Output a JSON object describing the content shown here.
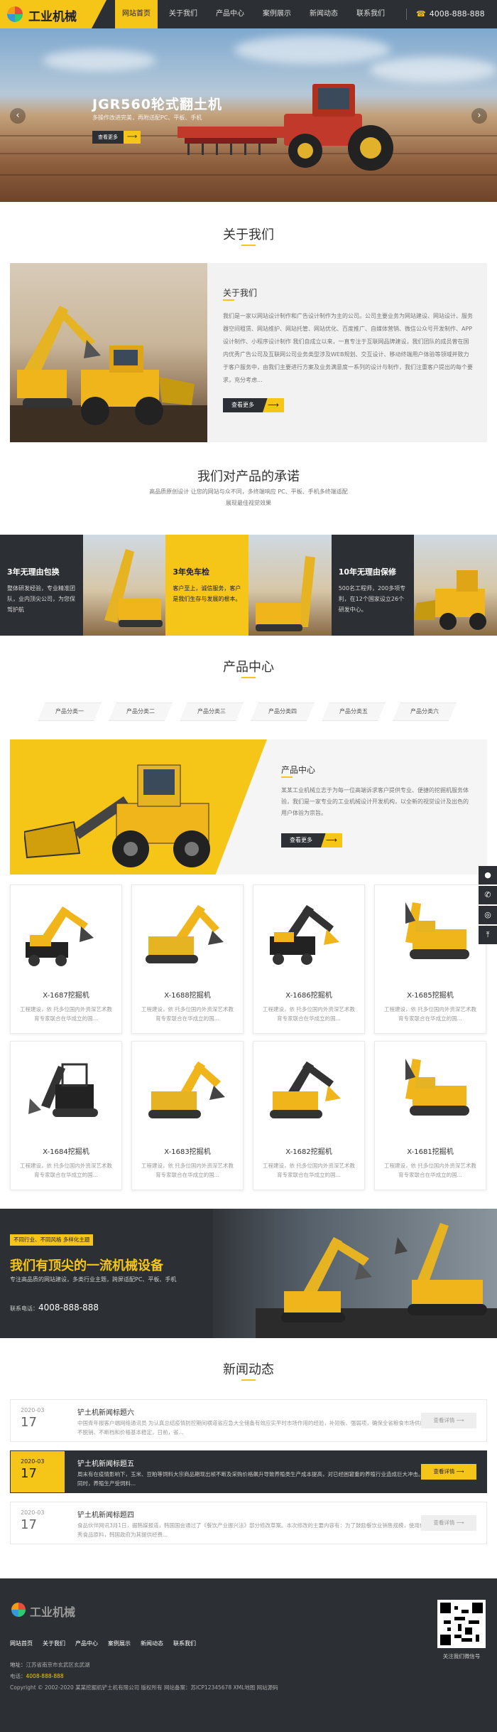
{
  "header": {
    "logo_text": "工业机械",
    "nav": [
      "网站首页",
      "关于我们",
      "产品中心",
      "案例展示",
      "新闻动态",
      "联系我们"
    ],
    "active_nav": 0,
    "phone_icon": "phone-icon",
    "phone": "4008-888-888"
  },
  "banner": {
    "title": "JGR560轮式翻土机",
    "subtitle": "多操作改进完美，再附送配PC、平板、手机",
    "button_label": "查看更多"
  },
  "about": {
    "section_title": "关于我们",
    "heading": "关于我们",
    "body": "我们是一家以网站设计制作和广告设计制作为主的公司。公司主要业务为网站建设、网站设计、服务器空间租赁、网站维护、网站托管、网站优化、百度推广、自媒体营销、微信公众号开发制作、APP设计制作、小程序设计制作 我们自成立以来，一直专注于互联网品牌建设，我们团队的成员曾在国内优秀广告公司及互联网公司业务类型涉及WEB规划、交互设计、移动终端用户体验等领域并致力于客户服务中，由我们主要进行方案及业务满意度一系列的设计与制作，我们注重客户提出的每个要求，充分考虑...",
    "button_label": "查看更多"
  },
  "promise": {
    "title": "我们对产品的承诺",
    "line1": "高品质原创设计 让您的网站与众不同，多终端响应 PC、平板、手机多终端适配",
    "line2": "展现最佳视觉效果",
    "items": [
      {
        "title": "3年无理由包换",
        "desc": "整体研发经验，专业精准团队，业内顶尖公司，为您保驾护航"
      },
      {
        "title": "3年免车检",
        "desc": "客户至上，诚信服务，客户是我们生存与发展的根本。"
      },
      {
        "title": "10年无理由保修",
        "desc": "500名工程师，200多项专利，在12个国家设立26个研发中心。"
      }
    ]
  },
  "products": {
    "section_title": "产品中心",
    "categories": [
      "产品分类一",
      "产品分类二",
      "产品分类三",
      "产品分类四",
      "产品分类五",
      "产品分类六"
    ],
    "heading": "产品中心",
    "body": "某某工业机械立志于为每一位高端诉求客户提供专业、便捷的挖掘机服务体验，我们是一家专业的工业机械设计开发机构，以全新的视觉设计及出色的用户体验为宗旨。",
    "button_label": "查看更多",
    "items": [
      {
        "name": "X-1687挖掘机",
        "desc": "工程建设，依 托多位国内外资深艺术教育专家联合在华成立的国..."
      },
      {
        "name": "X-1688挖掘机",
        "desc": "工程建设，依 托多位国内外资深艺术教育专家联合在华成立的国..."
      },
      {
        "name": "X-1686挖掘机",
        "desc": "工程建设，依 托多位国内外资深艺术教育专家联合在华成立的国..."
      },
      {
        "name": "X-1685挖掘机",
        "desc": "工程建设，依 托多位国内外资深艺术教育专家联合在华成立的国..."
      },
      {
        "name": "X-1684挖掘机",
        "desc": "工程建设，依 托多位国内外资深艺术教育专家联合在华成立的国..."
      },
      {
        "name": "X-1683挖掘机",
        "desc": "工程建设，依 托多位国内外资深艺术教育专家联合在华成立的国..."
      },
      {
        "name": "X-1682挖掘机",
        "desc": "工程建设，依 托多位国内外资深艺术教育专家联合在华成立的国..."
      },
      {
        "name": "X-1681挖掘机",
        "desc": "工程建设，依 托多位国内外资深艺术教育专家联合在华成立的国..."
      }
    ]
  },
  "side_tools": [
    "qq-icon",
    "phone-icon",
    "wechat-icon",
    "back-to-top-icon"
  ],
  "machinery": {
    "badge": "不同行业、不同风格 多样化主题",
    "title": "我们有顶尖的一流机械设备",
    "subtitle": "专注高品质的网站建设，多类行业主题，跨屏适配PC、平板、手机",
    "phone_label": "联系电话：",
    "phone": "4008-888-888"
  },
  "news": {
    "section_title": "新闻动态",
    "button_label": "查看详情 ⟶",
    "items": [
      {
        "ym": "2020-03",
        "day": "17",
        "title": "铲土机新闻标题六",
        "summary": "中国青年报客户端网络通讯员 为认真总结疫情防控期间横道省应急大全储备有效应实平时市场作用的经验，补短板、强弱项，确保全省粮食市场供应不脱销、不断档和价格基本稳定，日前，省..."
      },
      {
        "ym": "2020-03",
        "day": "17",
        "title": "铲土机新闻标题五",
        "summary": "周末有在疫情影响下，玉米、豆粕等饲料大宗商品期现出帧不断及采购价格飙升导致养殖类生产成本提高，对已经困窘重的养殖行业造成巨大冲击。同时，养殖生产受饲料..."
      },
      {
        "ym": "2020-03",
        "day": "17",
        "title": "铲土机新闻标题四",
        "summary": "食品伙伴网讯3月1日，据韩媒报道，韩国国会通过了《餐饮产业振兴法》部分修改草案。本次修改的主要内容有：为了鼓励餐饮业销售规模，使用优秀食品原料，韩国政府为其提供经费..."
      }
    ]
  },
  "footer": {
    "logo_text": "工业机械",
    "nav": [
      "网站首页",
      "关于我们",
      "产品中心",
      "案例展示",
      "新闻动态",
      "联系我们"
    ],
    "address_label": "地址：",
    "address": "江苏省南京市玄武区玄武湖",
    "phone_label": "电话：",
    "phone": "4008-888-888",
    "copyright": "Copyright © 2002-2020 某某挖掘机铲土机有限公司 版权所有 网站备案：苏ICP12345678 XML地图 网站源码",
    "qr_caption": "关注我们微信号"
  },
  "colors": {
    "accent": "#f5c518",
    "dark": "#2c2f33"
  }
}
